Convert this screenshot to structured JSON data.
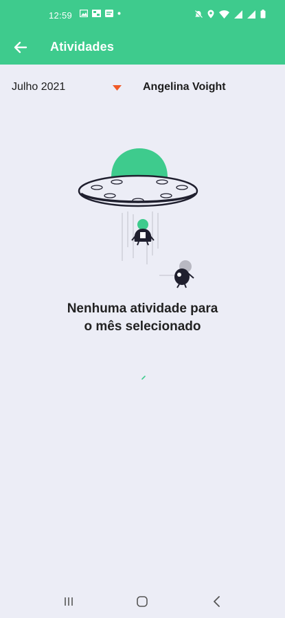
{
  "status_bar": {
    "time": "12:59",
    "left_icons": [
      "gallery-icon",
      "image-icon",
      "notification-icon",
      "dot-icon"
    ],
    "right_icons": [
      "mute-icon",
      "location-icon",
      "wifi-icon",
      "signal-icon",
      "signal-icon-2",
      "battery-icon"
    ]
  },
  "app_bar": {
    "title": "Atividades",
    "back_icon": "arrow-left-icon"
  },
  "filter": {
    "month": "Julho 2021",
    "user": "Angelina Voight",
    "accent": "#f05a28"
  },
  "empty_state": {
    "line1": "Nenhuma atividade para",
    "line2": "o mês selecionado"
  },
  "colors": {
    "primary": "#3ecb8d",
    "background": "#ecedf6"
  },
  "nav_bar": {
    "icons": [
      "recents-icon",
      "home-icon",
      "back-icon"
    ]
  }
}
